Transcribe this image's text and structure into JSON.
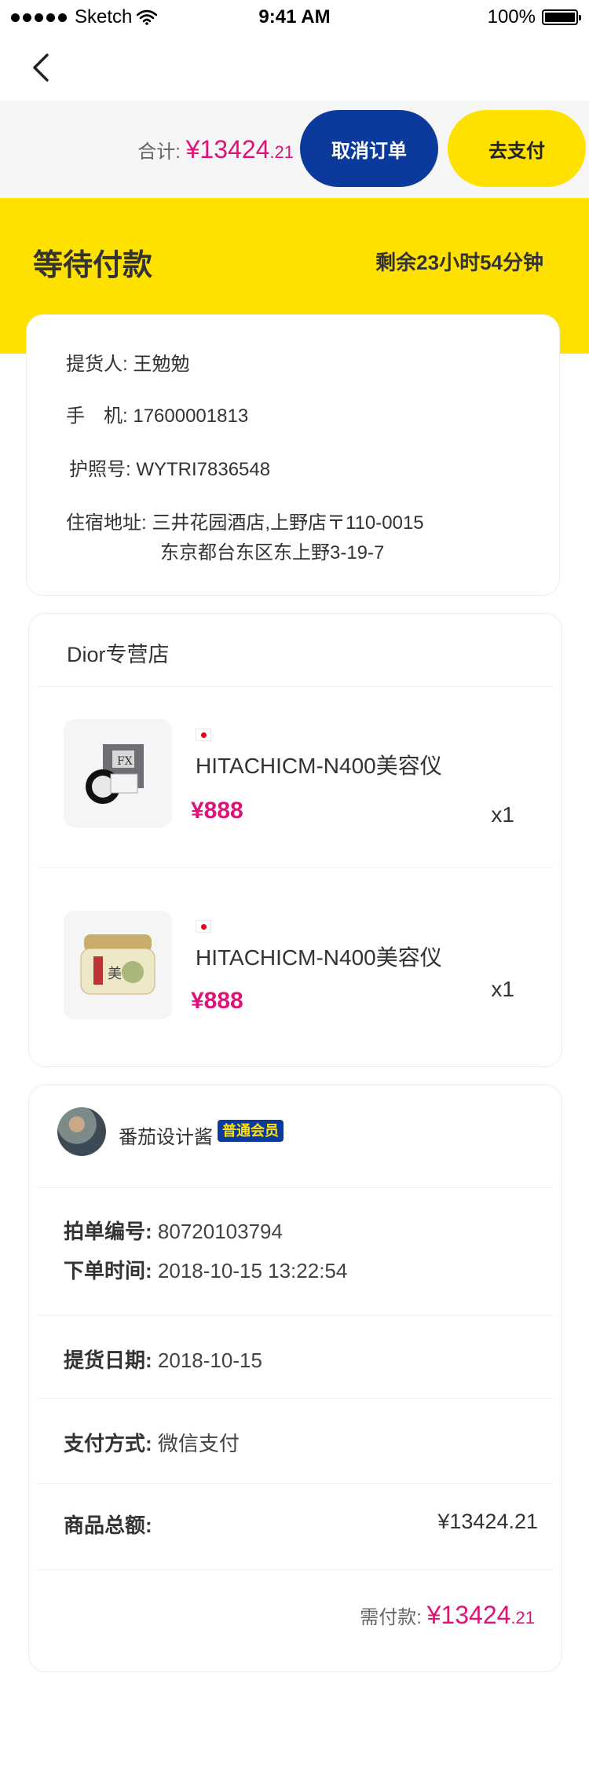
{
  "status_bar": {
    "carrier": "Sketch",
    "time": "9:41 AM",
    "battery": "100%"
  },
  "action_bar": {
    "total_label": "合计:",
    "total_currency": "¥",
    "total_int": "13424",
    "total_dec": ".21",
    "cancel_label": "取消订单",
    "pay_label": "去支付"
  },
  "banner": {
    "title": "等待付款",
    "remaining": "剩余23小时54分钟"
  },
  "pickup": {
    "person_label": "提货人:",
    "person": "王勉勉",
    "phone_label": "手　机:",
    "phone": "17600001813",
    "passport_label": "护照号:",
    "passport": "WYTRI7836548",
    "address_label": "住宿地址:",
    "address_line1": "三井花园酒店,上野店〒110-0015",
    "address_line2": "东京都台东区东上野3-19-7"
  },
  "shop": {
    "name": "Dior专营店",
    "products": [
      {
        "name": "HITACHICM-N400美容仪",
        "price": "¥888",
        "qty": "x1",
        "origin": "japan-flag-icon"
      },
      {
        "name": "HITACHICM-N400美容仪",
        "price": "¥888",
        "qty": "x1",
        "origin": "japan-flag-icon"
      }
    ]
  },
  "order": {
    "username": "番茄设计酱",
    "member_badge": "普通会员",
    "order_no_label": "拍单编号:",
    "order_no": "80720103794",
    "order_time_label": "下单时间:",
    "order_time": "2018-10-15 13:22:54",
    "pickup_date_label": "提货日期:",
    "pickup_date": "2018-10-15",
    "pay_method_label": "支付方式:",
    "pay_method": "微信支付",
    "goods_total_label": "商品总额:",
    "goods_total": "¥13424.21",
    "need_pay_label": "需付款:",
    "need_pay_currency": "¥",
    "need_pay_int": "13424",
    "need_pay_dec": ".21"
  },
  "colors": {
    "brand_blue": "#0b3a9c",
    "brand_yellow": "#ffe100",
    "price_pink": "#e0127a"
  }
}
